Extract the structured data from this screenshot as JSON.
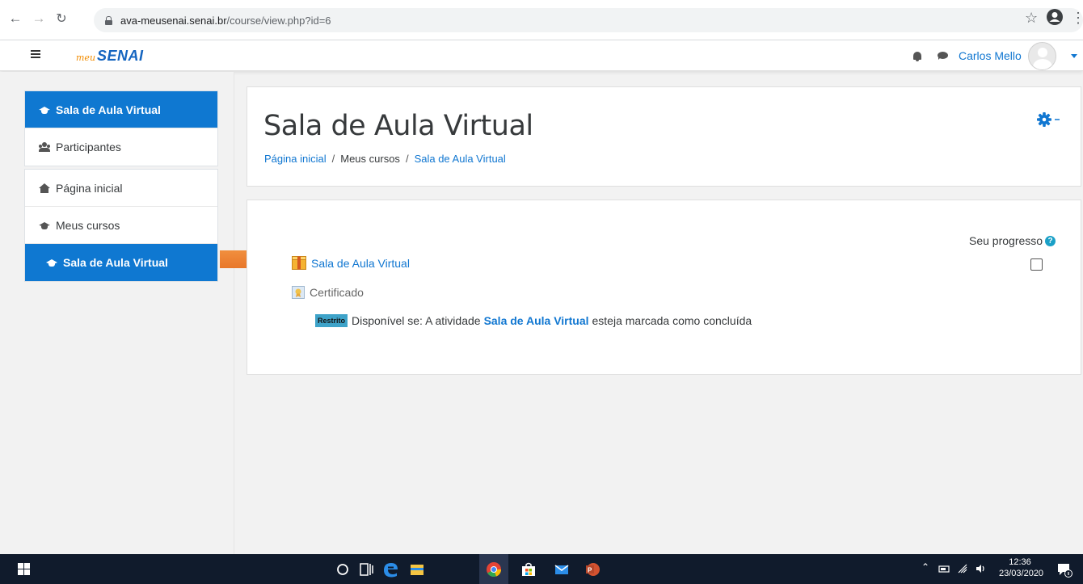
{
  "browser": {
    "url_host": "ava-meusenai.senai.br",
    "url_path": "/course/view.php?id=6",
    "icons": [
      "back-arrow-icon",
      "forward-arrow-icon",
      "reload-icon",
      "lock-icon",
      "star-icon",
      "account-icon",
      "more-vert-icon"
    ]
  },
  "navbar": {
    "brand_small": "meu",
    "brand_big": "SENAI",
    "user_name": "Carlos Mello"
  },
  "drawer": {
    "group1": [
      {
        "label": "Sala de Aula Virtual",
        "icon": "graduation-cap-icon",
        "active": true
      },
      {
        "label": "Participantes",
        "icon": "users-icon",
        "active": false
      }
    ],
    "group2": [
      {
        "label": "Página inicial",
        "icon": "home-icon",
        "active": false
      },
      {
        "label": "Meus cursos",
        "icon": "graduation-cap-icon",
        "active": false
      },
      {
        "label": "Sala de Aula Virtual",
        "icon": "graduation-cap-icon",
        "active": true
      }
    ]
  },
  "header": {
    "title": "Sala de Aula Virtual",
    "breadcrumb": {
      "home": "Página inicial",
      "sep1": "/",
      "courses": "Meus cursos",
      "sep2": "/",
      "current": "Sala de Aula Virtual"
    }
  },
  "content": {
    "progress_label": "Seu progresso",
    "help_symbol": "?",
    "activity1": "Sala de Aula Virtual",
    "activity2": "Certificado",
    "restriction": {
      "badge": "Restrito",
      "prefix": "Disponível se: A atividade",
      "activity": "Sala de Aula Virtual",
      "suffix": "esteja marcada como concluída"
    }
  },
  "taskbar": {
    "time": "12:36",
    "date": "23/03/2020"
  },
  "colors": {
    "accent": "#0f78d1",
    "link": "#1177d1",
    "arrow": "#f07c22",
    "taskbar": "#101b2c"
  }
}
